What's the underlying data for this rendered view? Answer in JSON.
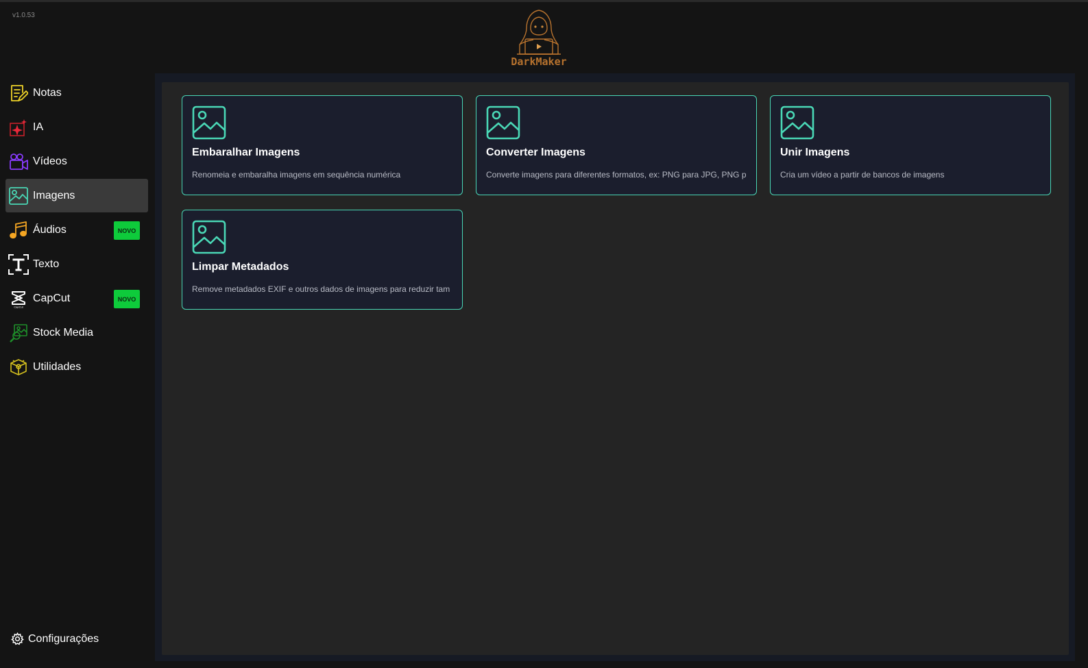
{
  "app": {
    "version": "v1.0.53",
    "logo_text": "DarkMaker"
  },
  "sidebar": {
    "items": [
      {
        "label": "Notas",
        "icon": "notes-icon"
      },
      {
        "label": "IA",
        "icon": "sparkle-icon"
      },
      {
        "label": "Vídeos",
        "icon": "video-camera-icon"
      },
      {
        "label": "Imagens",
        "icon": "image-icon",
        "active": true
      },
      {
        "label": "Áudios",
        "icon": "music-note-icon",
        "badge": "NOVO"
      },
      {
        "label": "Texto",
        "icon": "text-icon"
      },
      {
        "label": "CapCut",
        "icon": "capcut-icon",
        "badge": "NOVO"
      },
      {
        "label": "Stock Media",
        "icon": "stock-media-icon"
      },
      {
        "label": "Utilidades",
        "icon": "utilities-icon"
      }
    ],
    "settings_label": "Configurações"
  },
  "cards": [
    {
      "title": "Embaralhar Imagens",
      "description": "Renomeia e embaralha imagens em sequência numérica"
    },
    {
      "title": "Converter Imagens",
      "description": "Converte imagens para diferentes formatos, ex: PNG para JPG, PNG p"
    },
    {
      "title": "Unir Imagens",
      "description": "Cria um vídeo a partir de bancos de imagens"
    },
    {
      "title": "Limpar Metadados",
      "description": "Remove metadados EXIF e outros dados de imagens para reduzir tam"
    }
  ],
  "colors": {
    "accent": "#4ad8b6",
    "badge": "#0ecb3b",
    "logo": "#b8732e"
  }
}
